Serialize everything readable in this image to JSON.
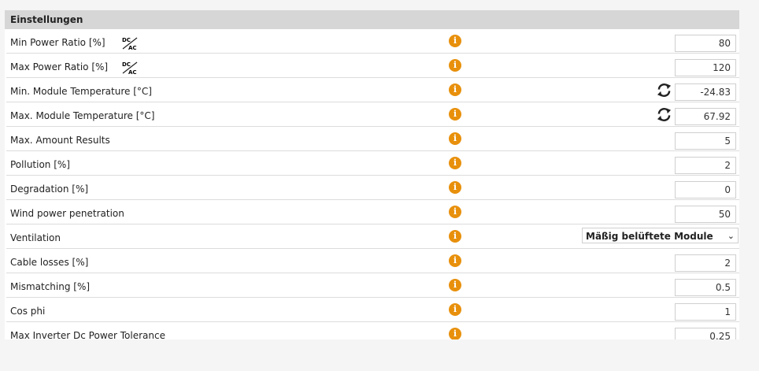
{
  "section_title": "Einstellungen",
  "rows": [
    {
      "label": "Min Power Ratio [%]",
      "value": "80",
      "dcac": true
    },
    {
      "label": "Max Power Ratio [%]",
      "value": "120",
      "dcac": true
    },
    {
      "label": "Min. Module Temperature [°C]",
      "value": "-24.83",
      "refresh": true
    },
    {
      "label": "Max. Module Temperature [°C]",
      "value": "67.92",
      "refresh": true
    },
    {
      "label": "Max. Amount Results",
      "value": "5"
    },
    {
      "label": "Pollution [%]",
      "value": "2"
    },
    {
      "label": "Degradation [%]",
      "value": "0"
    },
    {
      "label": "Wind power penetration",
      "value": "50"
    },
    {
      "label": "Ventilation",
      "select": "Mäßig belüftete Module"
    },
    {
      "label": "Cable losses [%]",
      "value": "2"
    },
    {
      "label": "Mismatching [%]",
      "value": "0.5"
    },
    {
      "label": "Cos phi",
      "value": "1"
    },
    {
      "label": "Max Inverter Dc Power Tolerance",
      "value": "0.25"
    }
  ],
  "dcac_icon": {
    "top": "DC",
    "bottom": "AC"
  },
  "info_icon_glyph": "i",
  "accent_color": "#e8900c"
}
